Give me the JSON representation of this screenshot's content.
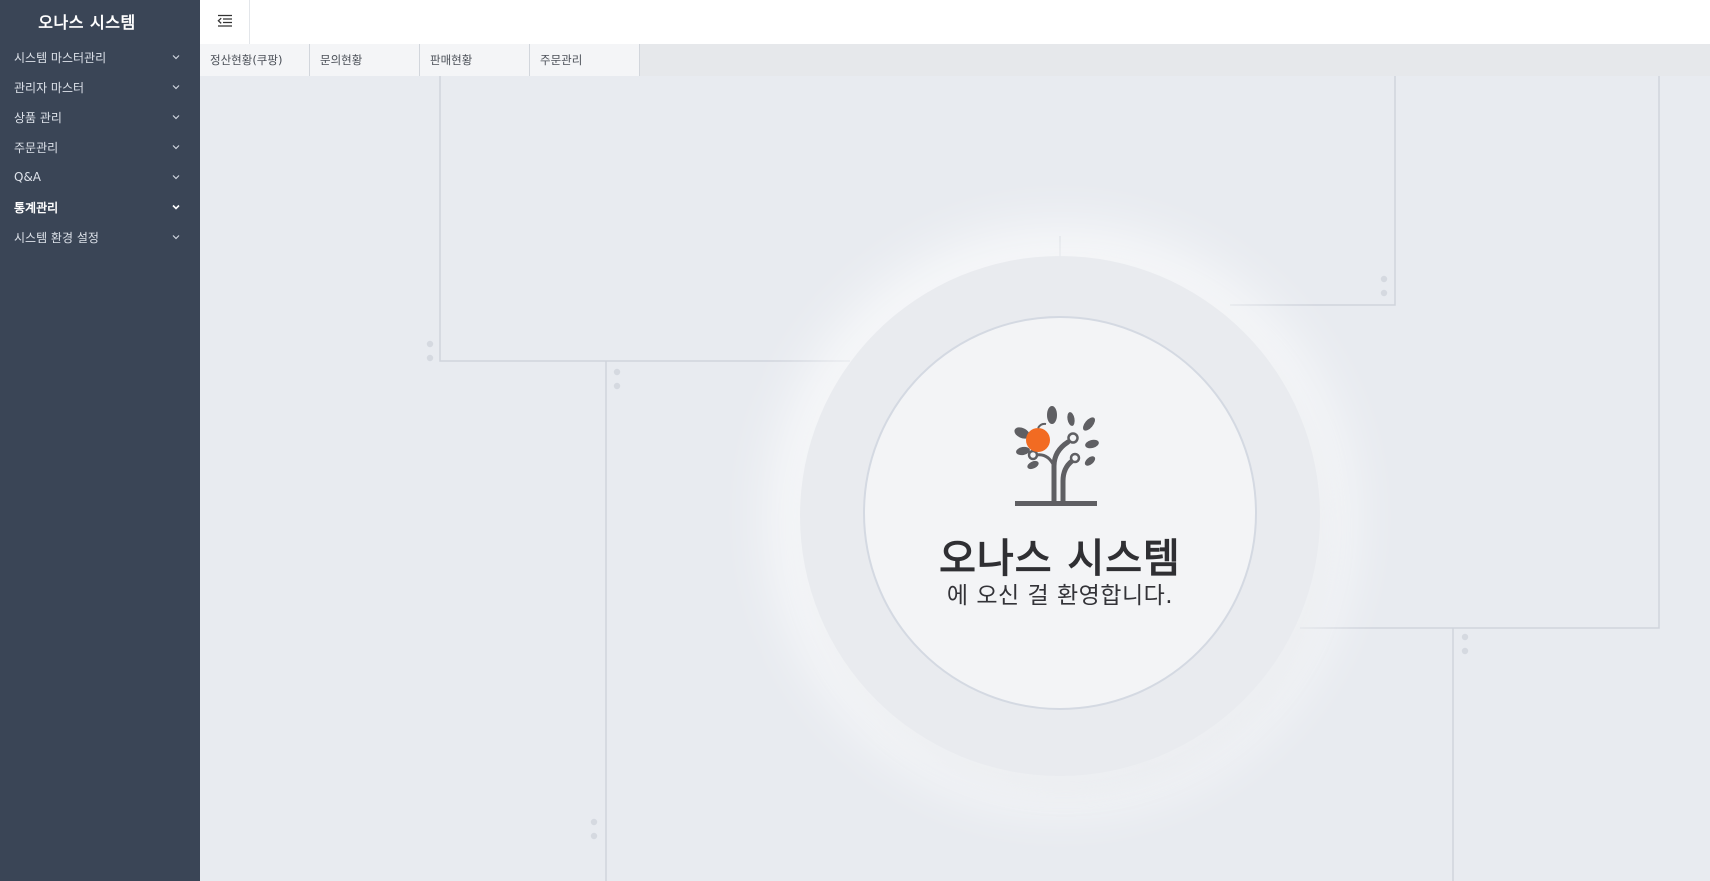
{
  "sidebar": {
    "brand": "오나스 시스템",
    "items": [
      {
        "label": "시스템 마스터관리"
      },
      {
        "label": "관리자 마스터"
      },
      {
        "label": "상품 관리"
      },
      {
        "label": "주문관리"
      },
      {
        "label": "Q&A"
      },
      {
        "label": "통계관리",
        "active": true
      },
      {
        "label": "시스템 환경 설정"
      }
    ]
  },
  "topbar": {
    "toggle_icon": "menu-collapse-icon"
  },
  "tabs": [
    {
      "label": "정산현황(쿠팡)"
    },
    {
      "label": "문의현황"
    },
    {
      "label": "판매현황"
    },
    {
      "label": "주문관리"
    }
  ],
  "welcome": {
    "title": "오나스 시스템",
    "subtitle": "에 오신 걸 환영합니다.",
    "logo_icon": "tree-apple-logo-icon"
  },
  "colors": {
    "sidebar_bg": "#3a4556",
    "main_bg": "#e8ebf0",
    "accent_orange": "#f26b22",
    "logo_gray": "#5f5f63"
  }
}
